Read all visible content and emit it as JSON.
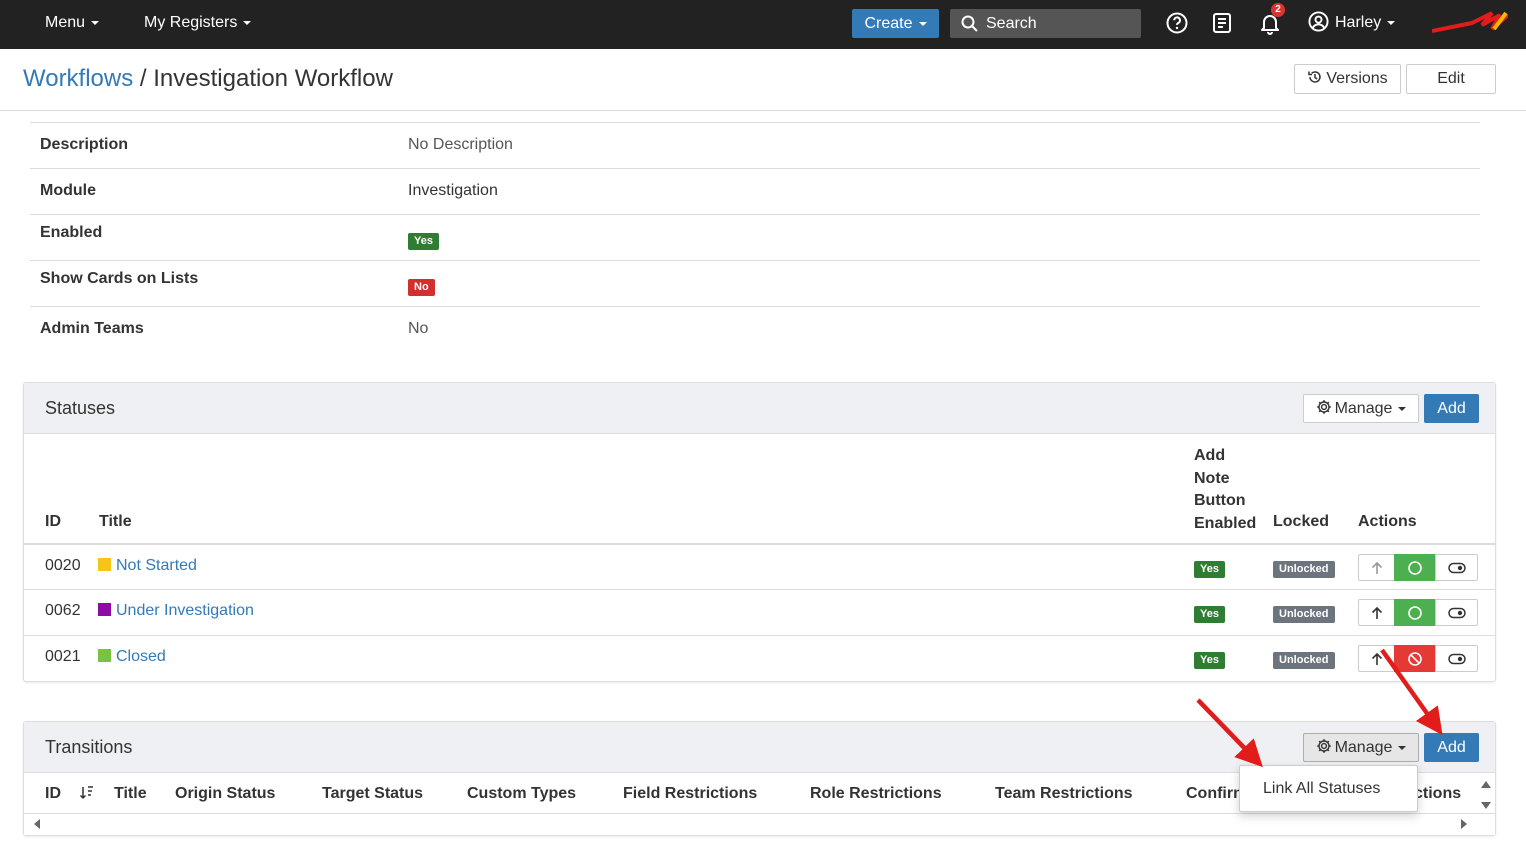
{
  "navbar": {
    "menu_label": "Menu",
    "registers_label": "My Registers",
    "create_label": "Create",
    "search_placeholder": "Search",
    "notification_count": "2",
    "user_name": "Harley"
  },
  "header": {
    "breadcrumb_parent": "Workflows",
    "separator": "/",
    "title": "Investigation Workflow",
    "versions_label": "Versions",
    "edit_label": "Edit"
  },
  "details": [
    {
      "label": "Description",
      "value": "No Description"
    },
    {
      "label": "Module",
      "value": "Investigation"
    },
    {
      "label": "Enabled",
      "badge": "Yes"
    },
    {
      "label": "Show Cards on Lists",
      "badge": "No"
    },
    {
      "label": "Admin Teams",
      "value": "No"
    }
  ],
  "statuses": {
    "title": "Statuses",
    "manage_label": "Manage",
    "add_label": "Add",
    "columns": {
      "id": "ID",
      "title": "Title",
      "add_note_1": "Add",
      "add_note_2": "Note",
      "add_note_3": "Button",
      "add_note_4": "Enabled",
      "locked": "Locked",
      "actions": "Actions"
    },
    "rows": [
      {
        "id": "0020",
        "title": "Not Started",
        "color": "#f5c518",
        "add_note": "Yes",
        "locked": "Unlocked",
        "state_color": "#4caf50"
      },
      {
        "id": "0062",
        "title": "Under Investigation",
        "color": "#8e0aa5",
        "add_note": "Yes",
        "locked": "Unlocked",
        "state_color": "#4caf50"
      },
      {
        "id": "0021",
        "title": "Closed",
        "color": "#7cc242",
        "add_note": "Yes",
        "locked": "Unlocked",
        "state_color": "#e53935"
      }
    ]
  },
  "transitions": {
    "title": "Transitions",
    "manage_label": "Manage",
    "add_label": "Add",
    "columns": {
      "id": "ID",
      "title": "Title",
      "origin": "Origin Status",
      "target": "Target Status",
      "custom_types": "Custom Types",
      "field_restrictions": "Field Restrictions",
      "role_restrictions": "Role Restrictions",
      "team_restrictions": "Team Restrictions",
      "confirm": "Confirn",
      "actions": "ctions"
    },
    "dropdown_item": "Link All Statuses"
  },
  "colors": {
    "navbar_bg": "#222222",
    "primary": "#337ab7",
    "success": "#2e7d32",
    "danger": "#d32f2f",
    "annotation_arrow": "#e21b1b"
  }
}
